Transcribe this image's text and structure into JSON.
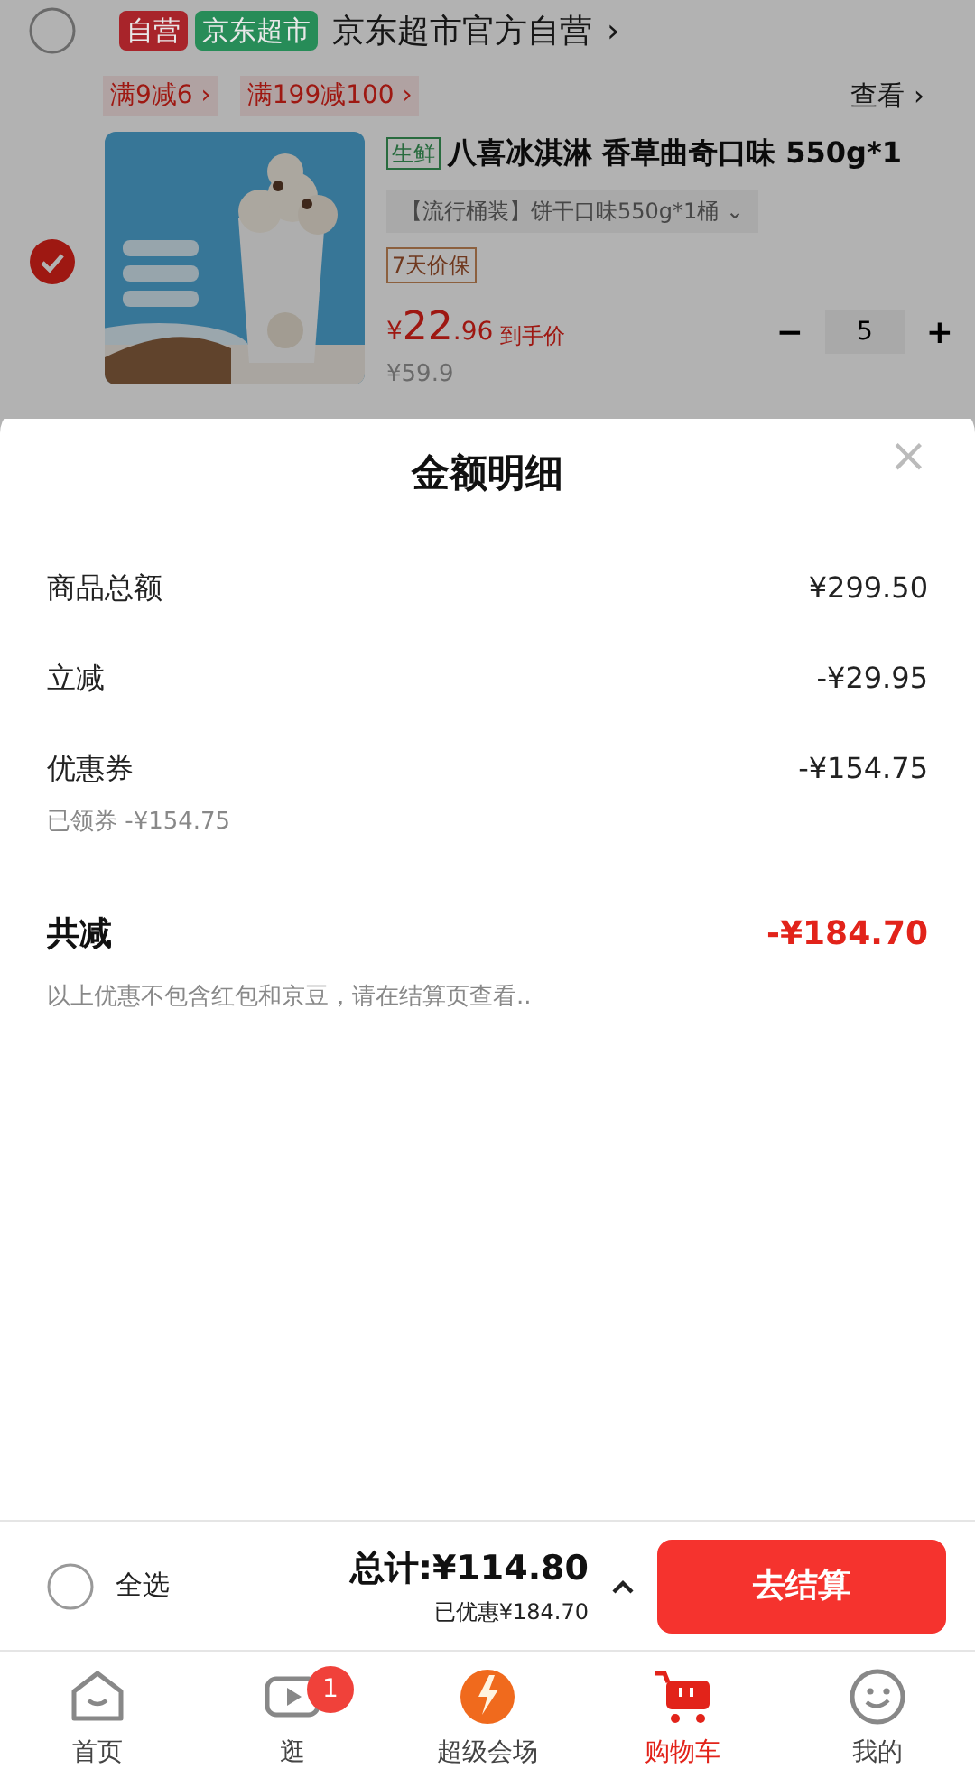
{
  "store": {
    "checked": false,
    "badges": [
      {
        "label": "自营",
        "color": "#a8242a"
      },
      {
        "label": "京东超市",
        "color": "#278c58"
      }
    ],
    "name": "京东超市官方自营",
    "arrow": "›"
  },
  "promos": [
    {
      "label": "满9减6 ›"
    },
    {
      "label": "满199减100 ›"
    }
  ],
  "view_link": "查看 ›",
  "product": {
    "checked": true,
    "tag": "生鲜",
    "title": "八喜冰淇淋 香草曲奇口味 550g*1",
    "variant": "【流行桶装】饼干口味550g*1桶",
    "variant_arrow": "⌄",
    "guarantee": "7天价保",
    "price_yuan": "¥22",
    "price_cents": ".96",
    "price_note": "到手价",
    "original_price": "¥59.9",
    "quantity": "5",
    "minus": "−",
    "plus": "+"
  },
  "sheet": {
    "title": "金额明细",
    "close": "×",
    "rows": [
      {
        "label": "商品总额",
        "value": "¥299.50"
      },
      {
        "label": "立减",
        "value": "-¥29.95"
      },
      {
        "label": "优惠券",
        "value": "-¥154.75",
        "sub": "已领券 -¥154.75"
      }
    ],
    "total": {
      "label": "共减",
      "value": "-¥184.70"
    },
    "note": "以上优惠不包含红包和京豆，请在结算页查看.."
  },
  "checkout": {
    "select_all": {
      "label": "全选",
      "checked": false
    },
    "total": "总计:¥114.80",
    "saved": "已优惠¥184.70",
    "button": "去结算"
  },
  "tabs": [
    {
      "label": "首页",
      "selected": false,
      "kind": "home"
    },
    {
      "label": "逛",
      "selected": false,
      "kind": "video",
      "badge": "1"
    },
    {
      "label": "超级会场",
      "selected": false,
      "kind": "promo"
    },
    {
      "label": "购物车",
      "selected": true,
      "kind": "cart"
    },
    {
      "label": "我的",
      "selected": false,
      "kind": "me"
    }
  ]
}
